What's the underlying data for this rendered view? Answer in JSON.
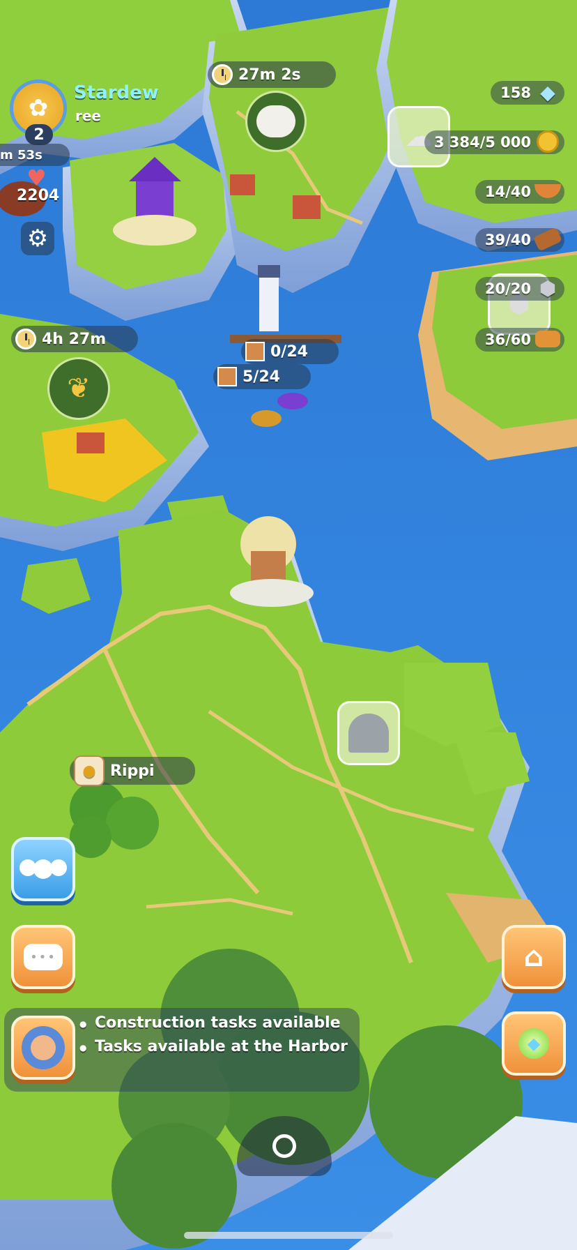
{
  "player": {
    "name": "Stardew",
    "subtitle": "ree",
    "level": "2",
    "partial_timer": "m 53s",
    "hearts": "2204"
  },
  "timers": {
    "top_building": "27m 2s",
    "farm": "4h 27m"
  },
  "harbor": {
    "cargo_a": "0/24",
    "cargo_b": "5/24"
  },
  "resources": {
    "gems": "158",
    "coins": "3 384/5 000",
    "soup": "14/40",
    "wood": "39/40",
    "stone": "20/20",
    "bread": "36/60"
  },
  "neighbor": {
    "name": "Rippi"
  },
  "tasks": {
    "line1": "Construction tasks available",
    "line2": "Tasks available at the Harbor"
  },
  "icons": {
    "settings": "gear-icon",
    "friends": "friends-icon",
    "chat": "chat-icon",
    "expand": "expand-icon",
    "compass": "compass-icon",
    "gem": "gem-icon",
    "coin": "coin-icon"
  },
  "colors": {
    "sea": "#2f7fd8",
    "grass": "#8ecb3a",
    "button_orange": "#f0913a",
    "button_blue": "#3b9de8",
    "player_name": "#8ff0ff"
  }
}
